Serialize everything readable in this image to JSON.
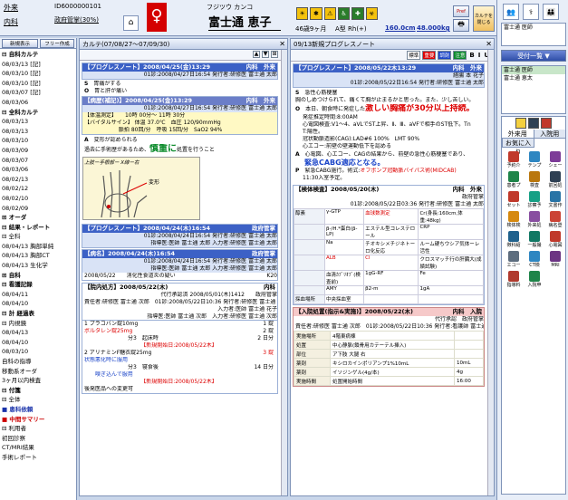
{
  "patient": {
    "type": "外来",
    "dept": "内科",
    "id": "ID6000000101",
    "insurance": "政府管掌(30%)",
    "kana": "フジツウ カンコ",
    "name": "富士通 恵子",
    "age": "46歳9ヶ月",
    "blood": "A型 Rh(+)",
    "height": "160.0cm",
    "weight": "48.000kg",
    "pref": "Pref",
    "btn_new": "新規表示",
    "btn_free": "フリー作成",
    "btn_close_line1": "カルテを",
    "btn_close_line2": "閉じる"
  },
  "tree": [
    {
      "t": "⊟ 自科カルテ",
      "b": true
    },
    {
      "t": "  08/03/13 [記]"
    },
    {
      "t": "  08/03/10 [記]"
    },
    {
      "t": "  08/03/10 [記]"
    },
    {
      "t": "  08/03/07 [記]"
    },
    {
      "t": "  08/03/06"
    },
    {
      "t": "⊟ 全科カルテ",
      "b": true
    },
    {
      "t": "  08/03/13"
    },
    {
      "t": "  08/03/13"
    },
    {
      "t": "  08/03/10"
    },
    {
      "t": "  08/03/09"
    },
    {
      "t": "  08/03/07"
    },
    {
      "t": "  08/03/06"
    },
    {
      "t": "  08/02/13"
    },
    {
      "t": "  08/02/12"
    },
    {
      "t": "  08/02/10"
    },
    {
      "t": "  08/02/09"
    },
    {
      "t": "⊞ オーダ",
      "b": true
    },
    {
      "t": "⊟ 結果・レポート",
      "b": true
    },
    {
      "t": "  ⊟ 全科"
    },
    {
      "t": "    08/04/13 胸部単純"
    },
    {
      "t": "    08/04/13 胸部CT"
    },
    {
      "t": "    08/04/13 生化学"
    },
    {
      "t": "⊞ 自科",
      "b": true
    },
    {
      "t": "⊟ 看護記録",
      "b": true
    },
    {
      "t": "    08/04/11"
    },
    {
      "t": "    08/04/10"
    },
    {
      "t": "⊟ 計 経過表",
      "b": true
    },
    {
      "t": "  ⊟ 内視鏡"
    },
    {
      "t": "    08/04/13"
    },
    {
      "t": "    08/04/10"
    },
    {
      "t": "    08/03/10"
    },
    {
      "t": "  自科の指導"
    },
    {
      "t": "  移動系オーダ"
    },
    {
      "t": "  3ヶ月以内検査"
    },
    {
      "t": "⊟ 付箋",
      "b": true
    },
    {
      "t": "  ⊟ 全体"
    },
    {
      "t": "    ■ 患科依頼",
      "b": true
    },
    {
      "t": "    ■ 中間サマリー",
      "b": true
    },
    {
      "t": "  ⊟ 利用者"
    },
    {
      "t": "    初回診察"
    },
    {
      "t": "    CT/MRI結果"
    },
    {
      "t": "    手術レポート"
    }
  ],
  "left_pane": {
    "title": "カルテ(07/08/27〜07/09/30)",
    "note1_head": "【プログレスノート】2008/04/25(金)13:29",
    "note1_dept": "内科　外来",
    "note1_sub": "01診:2008/04/27日16:54 発行者:研修医 富士通 太郎",
    "note1_s": "胃痛がする",
    "note1_o": "胃と肝が痛い",
    "vital_head": "【病歴(補記)】2008/04/25(金)13:29",
    "vital_dept": "内科　外来",
    "vital_sub": "01診:2008/04/27日16:54 発行者:研修医 富士通 太郎",
    "vital_rows": [
      "【体温測定】　　10時 00分〜 11時 30分",
      "【バイタルサイン】 体温 37.0℃　血圧 120/90mmHg",
      "　　　　　　 脈拍 80回/分　呼吸 15回/分　SaO2 94%"
    ],
    "a_text": "変形が認められる",
    "a_text2": "過去に手術歴があるため、",
    "a_green": "慎重に",
    "a_text3": "処置を行うこと",
    "draw_label": "上肢ー手根部ー X線ー右",
    "draw_note": "変形",
    "note2_head": "【プログレスノート】2008/04/24(木)16:54",
    "note2_dept": "政府管掌",
    "note2_sub": "01診:2008/04/24日16:54 発行者:研修医 富士通 太郎",
    "note2_sub2": "指導医:医師 富士通 太郎 入力者:研修医 富士通 太郎",
    "dx_head": "【病名】2008/04/24(木)16:54",
    "dx_dept": "政府管掌",
    "dx_sub": "01診:2008/04/24日16:54 発行者:研修医 富士通 太郎",
    "dx_sub2": "指導医:医師 富士通 太郎 入力者:研修医 富士通 太郎",
    "dx_row_date": "2008/05/22",
    "dx_row_name": "消化性食道炎の疑い",
    "dx_row_code": "K20",
    "rx_head": "【院内処方】2008/05/22(木)",
    "rx_dept": "内科",
    "rx_sub": "代行承認済 2008/05/01(木)1412　　政府管掌",
    "rx_sub2": "責任者:研修医 富士通 次郎　01診:2008/05/22日10:36 発行者:研修医 富士通 次郎",
    "rx_sub3": "入力者:医師 富士通 花子",
    "rx_sub4": "指導医:医師 富士通 次郎　入力者:研修医 富士通 次郎",
    "rx_items": [
      "1 プラコバン錠10mg",
      "ボルタレン錠25mg",
      "　　　　　　　　分3　起床時",
      "【新規開始日:2008/05/22木】",
      "2 アリナミンF糖衣錠25mg",
      "状態悪化時に服用",
      "　　　　　　　　分3　寝食後",
      "　　嗅ぎ込んで服用",
      "【新規開始日:2008/05/22木】",
      "後発医品への変更可"
    ],
    "rx_qty": [
      "1 錠",
      "2 錠",
      "2 日分",
      "",
      "3 錠",
      "",
      "14 日分",
      "",
      "",
      ""
    ]
  },
  "right_pane": {
    "title": "09/13新規プログレスノート",
    "tools": [
      "標準",
      "重要",
      "調剤",
      "注意"
    ],
    "note_head": "【プログレスノート】2008/05/22木13:29",
    "note_dept": "内科　外来",
    "note_dept2": "経腸 本 花子",
    "note_sub": "01診:2008/05/22日16:54 発行者:研修医 富士通 太郎",
    "s_text": "急性心筋梗塞",
    "s_text2": "胸のしめつけられて、痛くて胸が止まるかと思った。また、少し苦しい。",
    "o_text": "本日、朝食時に発症した",
    "o_red": "激しい胸痛が30分以上持続。",
    "o_lines": [
      "発症推定時間:8:00AM",
      "心電図検査:V1〜4、aVLでST上昇、Ⅱ、Ⅲ、aVFで相手のST低下。Tn",
      "T:陽性。",
      "冠状動脈造影(CAG):LAD#6 100%　LMT 90%",
      "心エコー:前壁の壁運動低下を認める"
    ],
    "a_text": "心電図、心エコー、CAGの結果から、前壁の急性心筋梗塞であり、",
    "a_blue": "緊急CABG適応となる。",
    "p_text": "緊急CABG施行。術式:",
    "p_red": "オフポンプ冠動脈バイパス術(MIDCAB)",
    "p_text2": "11:30入室予定。",
    "lab_head": "【検体検査】2008/05/20(木)",
    "lab_dept": "内科　外来",
    "lab_dept2": "政府管掌",
    "lab_sub": "01診:2008/05/22日03:36 発行者:研修医 富士通 太郎",
    "lab_rows": [
      [
        "醇素",
        "γ-GTP",
        "血球数測定",
        "Cr(身長:160cm,体重:48kg)"
      ],
      [
        "",
        "β-/H.*蛋白(β-LP)",
        "エステル型コレステロール",
        "CRP"
      ],
      [
        "",
        "Na",
        "チオキシメチジネトーロ化反応",
        "ルーム硬ちウシア気体ーレ活性"
      ],
      [
        "",
        "ALB",
        "Cl",
        "クロスマッチ行の肝臓大(成績試験)"
      ],
      [
        "",
        "血清ｶﾌﾞﾘｵﾌﾞ(検査前)",
        "1gG-RF",
        "Fe"
      ],
      [
        "",
        "AMY",
        "β2-m",
        "1gA"
      ],
      [
        "採血場所",
        "中央採血室",
        "",
        ""
      ]
    ],
    "trt_head": "【入院処置(指示&実施)】2008/05/22(木)",
    "trt_dept": "内科　入院",
    "trt_sub": "代行承認　政府管掌",
    "trt_sub2": "責任者:研修医 富士通 次郎　01診:2008/05/22日10:36 発行者:看護師 富士通 看護師",
    "trt_rows": [
      [
        "実施場所",
        "4階東病棟",
        ""
      ],
      [
        "処置",
        "中心静脈(鎖骨用カテーテル挿入)",
        ""
      ],
      [
        "部位",
        "ア下肢 大腿 右",
        ""
      ],
      [
        "薬剤",
        "キシロカインポリアンプ1%10mL",
        "10mL"
      ],
      [
        "薬剤",
        "イソジンゲル(4g/本)",
        "4g"
      ],
      [
        "実施時間",
        "処置開始時間",
        "16:00"
      ]
    ]
  },
  "side": {
    "staff": [
      "富士通 医師"
    ],
    "staff2": [
      "富士通 医師",
      "富士通 恵太"
    ],
    "order_label": "受付一覧",
    "tab1": "外来用",
    "tab2": "入院用",
    "tab3": "お気に入り",
    "icons": [
      [
        "予約介",
        "#c0392b"
      ],
      [
        "テンプ",
        "#2e86c1"
      ],
      [
        "シェー",
        "#7d3c98"
      ],
      [
        "患者プ",
        "#1e8449"
      ],
      [
        "検査",
        "#b9770e"
      ],
      [
        "前回処",
        "#2e4053"
      ],
      [
        "セット",
        "#c0392b"
      ],
      [
        "診察予",
        "#16a085"
      ],
      [
        "文書作",
        "#2874a6"
      ],
      [
        "検体検",
        "#d68910"
      ],
      [
        "外来処",
        "#884ea0"
      ],
      [
        "病名登",
        "#cb4335"
      ],
      [
        "徴科紹",
        "#1f618d"
      ],
      [
        "一般撮",
        "#117864"
      ],
      [
        "心電図",
        "#c0392b"
      ],
      [
        "エコー",
        "#5d6d7e"
      ],
      [
        "CT検",
        "#2e86c1"
      ],
      [
        "MRI",
        "#6c3483"
      ],
      [
        "指導料",
        "#b03a2e"
      ],
      [
        "入院申",
        "#1e8449"
      ]
    ]
  }
}
